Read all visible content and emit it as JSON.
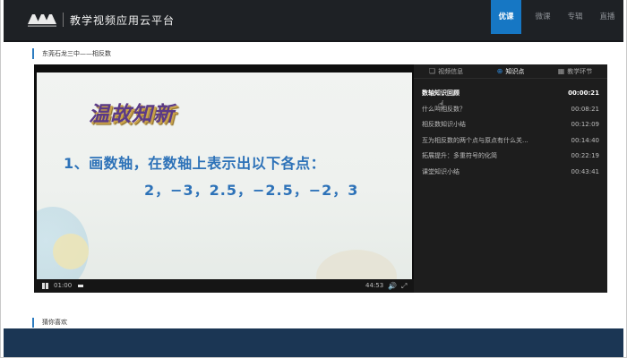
{
  "header": {
    "brand": "教学视频应用云平台",
    "nav": [
      "优课",
      "微课",
      "专辑",
      "直播"
    ]
  },
  "breadcrumb": "东莞石龙三中——相反数",
  "slide": {
    "title": "温故知新",
    "line1": "1、画数轴，在数轴上表示出以下各点：",
    "line2": "2，−3，2.5，−2.5，−2，3"
  },
  "player": {
    "current_time": "01:00",
    "duration": "44:53"
  },
  "panel": {
    "tabs": [
      "视频信息",
      "知识点",
      "教学环节"
    ],
    "active_tab": "知识点",
    "items": [
      {
        "title": "数轴知识回顾",
        "time": "00:00:21"
      },
      {
        "title": "什么叫相反数？",
        "time": "00:08:21"
      },
      {
        "title": "相反数知识小结",
        "time": "00:12:09"
      },
      {
        "title": "互为相反数的两个点与原点有什么关...",
        "time": "00:14:40"
      },
      {
        "title": "拓展提升：多重符号的化简",
        "time": "00:22:19"
      },
      {
        "title": "课堂知识小结",
        "time": "00:43:41"
      }
    ]
  },
  "section2": "猜你喜欢",
  "colors": {
    "nav_active": "#1677c4",
    "header_bg": "#1e2125",
    "accent": "#2d7cc0",
    "footer_bg": "#1b3654"
  }
}
